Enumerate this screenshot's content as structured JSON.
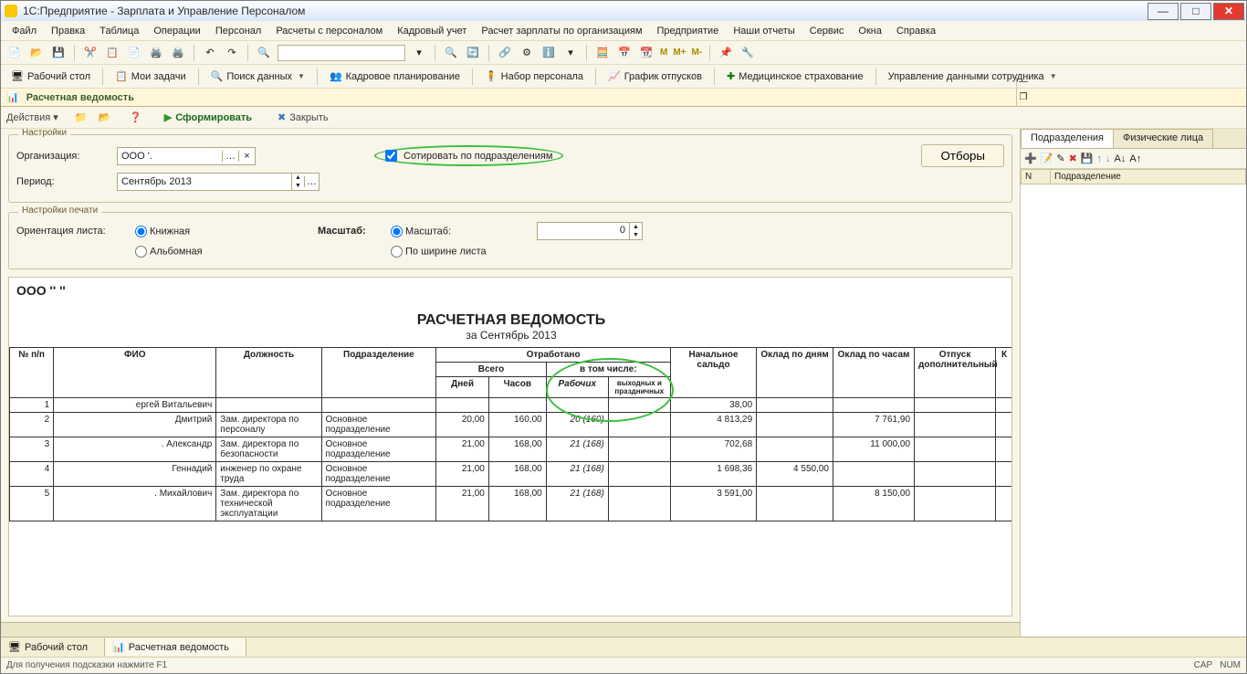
{
  "title": "1С:Предприятие -           Зарплата и Управление Персоналом",
  "menu": [
    "Файл",
    "Правка",
    "Таблица",
    "Операции",
    "Персонал",
    "Расчеты с персоналом",
    "Кадровый учет",
    "Расчет зарплаты по организациям",
    "Предприятие",
    "Наши отчеты",
    "Сервис",
    "Окна",
    "Справка"
  ],
  "toolbar2": {
    "desktop": "Рабочий стол",
    "tasks": "Мои задачи",
    "search": "Поиск данных",
    "plan": "Кадровое планирование",
    "recruit": "Набор персонала",
    "vac": "График отпусков",
    "med": "Медицинское страхование",
    "emp": "Управление данными сотрудника"
  },
  "m_labels": {
    "m": "M",
    "mp": "M+",
    "mm": "M-"
  },
  "doc": {
    "title": "Расчетная ведомость"
  },
  "actionbar": {
    "actions": "Действия",
    "form": "Сформировать",
    "close": "Закрыть"
  },
  "settings": {
    "legend": "Настройки",
    "org_label": "Организация:",
    "org_value": "ООО '.",
    "period_label": "Период:",
    "period_value": "Сентябрь 2013",
    "sort_label": "Сотировать по подразделениям",
    "otbory": "Отборы"
  },
  "print": {
    "legend": "Настройки печати",
    "orient_label": "Ориентация листа:",
    "book": "Книжная",
    "album": "Альбомная",
    "scale_label": "Масштаб:",
    "opt_scale": "Масштаб:",
    "opt_width": "По ширине листа",
    "scale_value": "0"
  },
  "report": {
    "company": "ООО ''                         ''",
    "title": "РАСЧЕТНАЯ ВЕДОМОСТЬ",
    "period": "за Сентябрь 2013",
    "cols": {
      "npp": "№ п/п",
      "fio": "ФИО",
      "post": "Должность",
      "dept": "Подразделение",
      "worked": "Отработано",
      "total": "Всего",
      "incl": "в том числе:",
      "days": "Дней",
      "hours": "Часов",
      "workdays": "Рабочих",
      "holidays": "выходных и праздничных",
      "start_saldo": "Начальное сальдо",
      "salary_days": "Оклад по дням",
      "salary_hours": "Оклад по часам",
      "vacation": "Отпуск дополнительный",
      "comp": "К"
    },
    "rows": [
      {
        "n": "1",
        "fio": "ергей Витальевич",
        "post": "",
        "dept": "",
        "days": "",
        "hours": "",
        "wd": "",
        "hd": "",
        "saldo": "38,00",
        "sd": "",
        "sh": "",
        "vac": ""
      },
      {
        "n": "2",
        "fio": "Дмитрий",
        "post": "Зам. директора по персоналу",
        "dept": "Основное подразделение",
        "days": "20,00",
        "hours": "160,00",
        "wd": "20 (160)",
        "hd": "",
        "saldo": "4 813,29",
        "sd": "",
        "sh": "7 761,90",
        "vac": ""
      },
      {
        "n": "3",
        "fio": ". Александр",
        "post": "Зам. директора по безопасности",
        "dept": "Основное подразделение",
        "days": "21,00",
        "hours": "168,00",
        "wd": "21 (168)",
        "hd": "",
        "saldo": "702,68",
        "sd": "",
        "sh": "11 000,00",
        "vac": ""
      },
      {
        "n": "4",
        "fio": "Геннадий",
        "post": "инженер по охране труда",
        "dept": "Основное подразделение",
        "days": "21,00",
        "hours": "168,00",
        "wd": "21 (168)",
        "hd": "",
        "saldo": "1 698,36",
        "sd": "4 550,00",
        "sh": "",
        "vac": ""
      },
      {
        "n": "5",
        "fio": ". Михайлович",
        "post": "Зам. директора по технической эксплуатации",
        "dept": "Основное подразделение",
        "days": "21,00",
        "hours": "168,00",
        "wd": "21 (168)",
        "hd": "",
        "saldo": "3 591,00",
        "sd": "",
        "sh": "8 150,00",
        "vac": ""
      }
    ]
  },
  "rightpanel": {
    "tab1": "Подразделения",
    "tab2": "Физические лица",
    "col_n": "N",
    "col_dept": "Подразделение"
  },
  "wintabs": {
    "desktop": "Рабочий стол",
    "doc": "Расчетная ведомость"
  },
  "status": {
    "hint": "Для получения подсказки нажмите F1",
    "cap": "CAP",
    "num": "NUM"
  }
}
